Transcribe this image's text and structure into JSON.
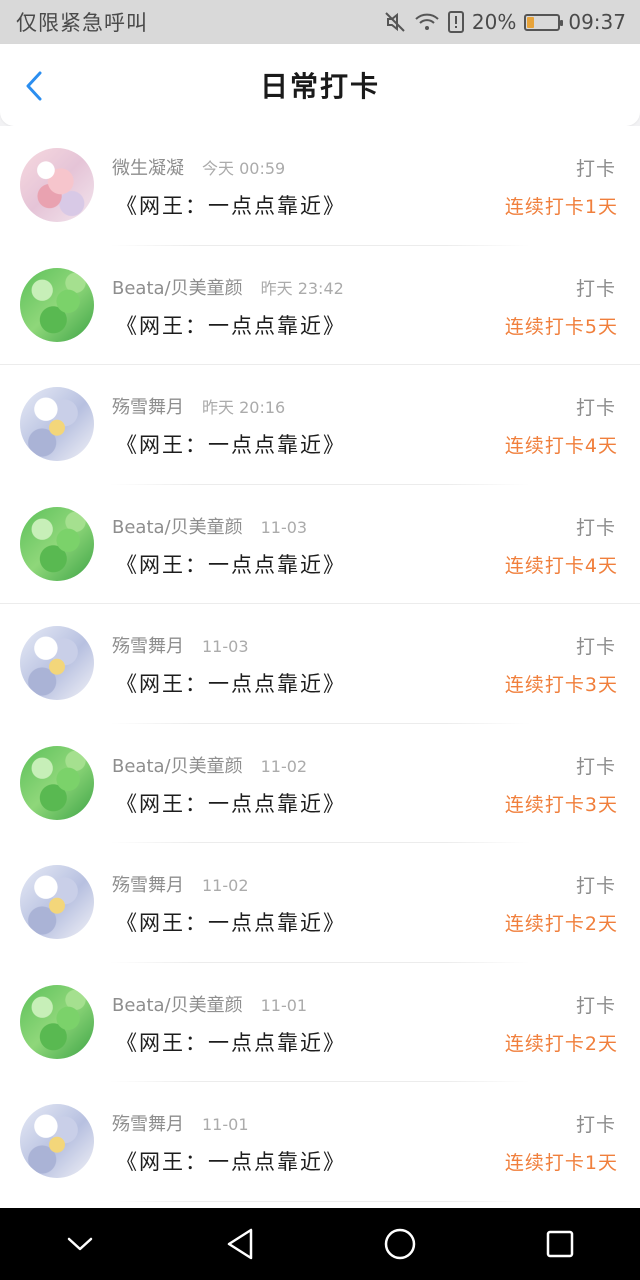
{
  "status_bar": {
    "carrier": "仅限紧急呼叫",
    "battery": "20%",
    "time": "09:37",
    "icons": [
      "mute-icon",
      "wifi-icon",
      "sim-alert-icon",
      "battery-icon"
    ]
  },
  "header": {
    "title": "日常打卡",
    "back_icon": "chevron-left-icon"
  },
  "colors": {
    "accent": "#2b8ef0",
    "streak": "#f07f3c"
  },
  "records": [
    {
      "name": "微生凝凝",
      "time": "今天 00:59",
      "title": "《网王：一点点靠近》",
      "action": "打卡",
      "streak": "连续打卡1天",
      "avatar": "pink"
    },
    {
      "name": "Beata/贝美童颜",
      "time": "昨天 23:42",
      "title": "《网王：一点点靠近》",
      "action": "打卡",
      "streak": "连续打卡5天",
      "avatar": "green"
    },
    {
      "name": "殇雪舞月",
      "time": "昨天 20:16",
      "title": "《网王：一点点靠近》",
      "action": "打卡",
      "streak": "连续打卡4天",
      "avatar": "blue"
    },
    {
      "name": "Beata/贝美童颜",
      "time": "11-03",
      "title": "《网王：一点点靠近》",
      "action": "打卡",
      "streak": "连续打卡4天",
      "avatar": "green"
    },
    {
      "name": "殇雪舞月",
      "time": "11-03",
      "title": "《网王：一点点靠近》",
      "action": "打卡",
      "streak": "连续打卡3天",
      "avatar": "blue"
    },
    {
      "name": "Beata/贝美童颜",
      "time": "11-02",
      "title": "《网王：一点点靠近》",
      "action": "打卡",
      "streak": "连续打卡3天",
      "avatar": "green"
    },
    {
      "name": "殇雪舞月",
      "time": "11-02",
      "title": "《网王：一点点靠近》",
      "action": "打卡",
      "streak": "连续打卡2天",
      "avatar": "blue"
    },
    {
      "name": "Beata/贝美童颜",
      "time": "11-01",
      "title": "《网王：一点点靠近》",
      "action": "打卡",
      "streak": "连续打卡2天",
      "avatar": "green"
    },
    {
      "name": "殇雪舞月",
      "time": "11-01",
      "title": "《网王：一点点靠近》",
      "action": "打卡",
      "streak": "连续打卡1天",
      "avatar": "blue"
    }
  ],
  "nav_bar": {
    "buttons": [
      "collapse-icon",
      "back-triangle-icon",
      "home-circle-icon",
      "recents-square-icon"
    ]
  }
}
